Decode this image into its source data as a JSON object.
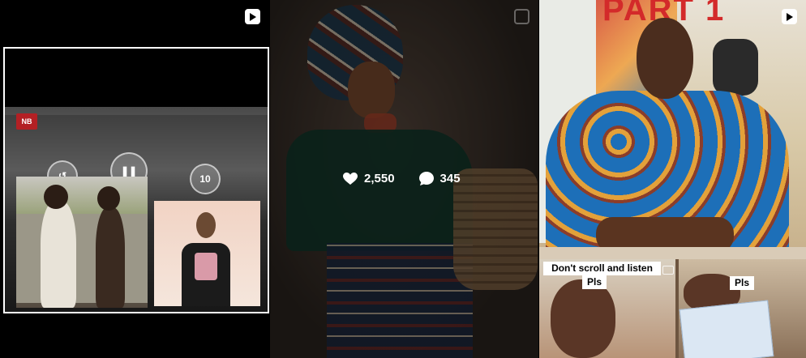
{
  "posts": [
    {
      "type_icon": "reel-icon"
    },
    {
      "type_icon": "carousel-icon",
      "stats": {
        "likes": "2,550",
        "comments": "345"
      }
    },
    {
      "type_icon": "reel-icon",
      "title_text": "PART 1",
      "caption_left_line1": "Don't scroll and listen",
      "caption_left_line2": "Pls",
      "caption_right": "Pls",
      "logo_text": "NB"
    }
  ],
  "colors": {
    "overlay": "rgba(0,0,0,0.42)",
    "frame": "#ffffff",
    "title_red": "#d32a2a"
  }
}
